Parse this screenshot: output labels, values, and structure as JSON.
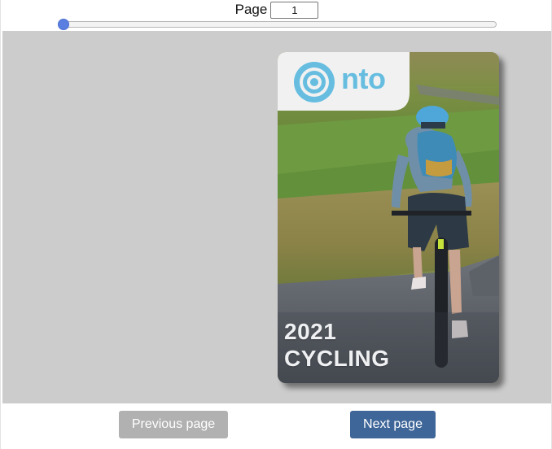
{
  "pager": {
    "label": "Page",
    "current_page": "1",
    "slider_fraction": 0
  },
  "cover": {
    "brand": "nto",
    "year": "2021",
    "title": "CYCLING"
  },
  "buttons": {
    "previous_label": "Previous page",
    "next_label": "Next page"
  },
  "colors": {
    "viewer_background": "#cccccc",
    "next_button": "#3f6699",
    "previous_button_disabled": "#b1b1b1",
    "slider_thumb": "#5b7fe0",
    "brand_blue": "#66bde0"
  }
}
